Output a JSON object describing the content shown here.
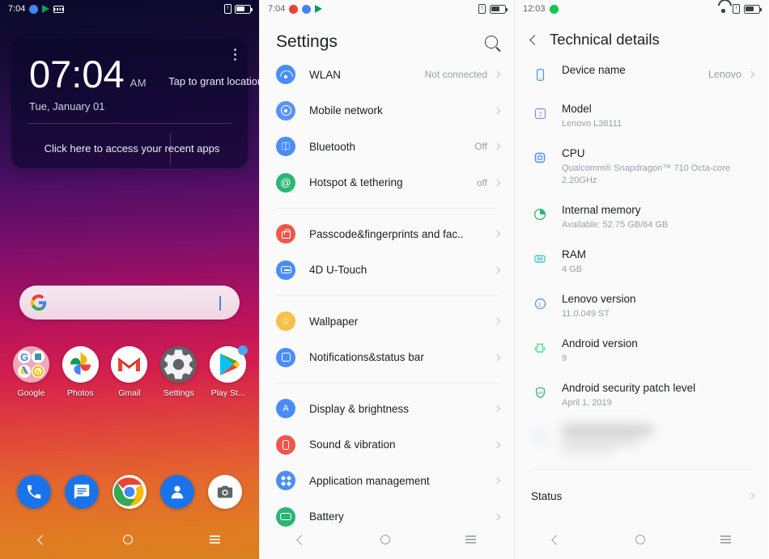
{
  "home": {
    "statusbar": {
      "time": "7:04",
      "icons": [
        "blue-dot-icon",
        "play-store-icon",
        "keyboard-icon"
      ],
      "sim_icon": "sim-card-icon",
      "battery_icon": "battery-icon"
    },
    "clock_widget": {
      "time": "07:04",
      "ampm": "AM",
      "location_prompt": "Tap to grant location",
      "date": "Tue, January 01",
      "recent_apps_text": "Click here to access your recent apps",
      "overflow_icon": "more-vertical-icon"
    },
    "search": {
      "google_icon": "google-g-icon",
      "mic_icon": "microphone-icon",
      "placeholder": ""
    },
    "apps": [
      {
        "label": "Google",
        "icon": "google-folder-icon"
      },
      {
        "label": "Photos",
        "icon": "google-photos-icon"
      },
      {
        "label": "Gmail",
        "icon": "gmail-icon"
      },
      {
        "label": "Settings",
        "icon": "settings-gear-icon"
      },
      {
        "label": "Play St...",
        "icon": "play-store-icon"
      }
    ],
    "dock": [
      {
        "name": "phone-icon"
      },
      {
        "name": "messages-icon"
      },
      {
        "name": "chrome-icon"
      },
      {
        "name": "contacts-icon"
      },
      {
        "name": "camera-icon"
      }
    ],
    "navbar": {
      "back": "back-icon",
      "home": "home-icon",
      "recents": "recents-icon"
    }
  },
  "settings": {
    "statusbar": {
      "time": "7:04",
      "sim_icon": "sim-card-icon",
      "battery_icon": "battery-icon"
    },
    "title": "Settings",
    "search_icon": "search-icon",
    "groups": [
      {
        "items": [
          {
            "label": "WLAN",
            "value": "Not connected",
            "icon": "wifi-icon",
            "color": "#4b8df8"
          },
          {
            "label": "Mobile network",
            "value": "",
            "icon": "mobile-network-icon",
            "color": "#5c92f8"
          },
          {
            "label": "Bluetooth",
            "value": "Off",
            "icon": "bluetooth-icon",
            "color": "#4b8df8"
          },
          {
            "label": "Hotspot & tethering",
            "value": "off",
            "icon": "hotspot-icon",
            "color": "#2bb673"
          }
        ]
      },
      {
        "items": [
          {
            "label": "Passcode&fingerprints and fac..",
            "value": "",
            "icon": "lock-icon",
            "color": "#f0564a"
          },
          {
            "label": "4D U-Touch",
            "value": "",
            "icon": "u-touch-icon",
            "color": "#4b8df8"
          }
        ]
      },
      {
        "items": [
          {
            "label": "Wallpaper",
            "value": "",
            "icon": "star-icon",
            "color": "#f7c04a"
          },
          {
            "label": "Notifications&status bar",
            "value": "",
            "icon": "notifications-icon",
            "color": "#4b8df8"
          }
        ]
      },
      {
        "items": [
          {
            "label": "Display & brightness",
            "value": "",
            "icon": "brightness-icon",
            "color": "#4b8df8"
          },
          {
            "label": "Sound & vibration",
            "value": "",
            "icon": "vibration-icon",
            "color": "#f0564a"
          },
          {
            "label": "Application management",
            "value": "",
            "icon": "apps-grid-icon",
            "color": "#4b8df8"
          },
          {
            "label": "Battery",
            "value": "",
            "icon": "battery-icon",
            "color": "#2bb673"
          }
        ]
      }
    ],
    "navbar": {
      "back": "back-icon",
      "home": "home-icon",
      "recents": "recents-icon"
    }
  },
  "technical": {
    "statusbar": {
      "time": "12:03",
      "dot_icon": "green-dot-icon",
      "wifi_icon": "wifi-icon",
      "sim_icon": "sim-card-icon",
      "battery_icon": "battery-icon"
    },
    "back_icon": "back-arrow-icon",
    "title": "Technical details",
    "items": [
      {
        "label": "Device name",
        "sub": "",
        "value": "Lenovo",
        "chevron": true,
        "icon": "phone-outline-icon",
        "color": "#4b8df8"
      },
      {
        "label": "Model",
        "sub": "Lenovo L38111",
        "value": "",
        "chevron": false,
        "icon": "model-z-icon",
        "color": "#9b7fe0"
      },
      {
        "label": "CPU",
        "sub": "Qualcomm® Snapdragon™ 710 Octa-core 2.20GHz",
        "value": "",
        "chevron": false,
        "icon": "cpu-icon",
        "color": "#4b8df8"
      },
      {
        "label": "Internal memory",
        "sub": "Available: 52.75 GB/64 GB",
        "value": "",
        "chevron": false,
        "icon": "pie-chart-icon",
        "color": "#2bb673"
      },
      {
        "label": "RAM",
        "sub": "4 GB",
        "value": "",
        "chevron": false,
        "icon": "ram-chip-icon",
        "color": "#3ec6cf"
      },
      {
        "label": "Lenovo version",
        "sub": "11.0.049 ST",
        "value": "",
        "chevron": false,
        "icon": "lenovo-l-icon",
        "color": "#4b8df8"
      },
      {
        "label": "Android version",
        "sub": "9",
        "value": "",
        "chevron": false,
        "icon": "android-robot-icon",
        "color": "#3ddc84"
      },
      {
        "label": "Android security patch level",
        "sub": "April 1, 2019",
        "value": "",
        "chevron": false,
        "icon": "shield-icon",
        "color": "#2bb673"
      }
    ],
    "redacted_row": {
      "label": "",
      "sub": "",
      "note": "blurred"
    },
    "status_label": "Status",
    "navbar": {
      "back": "back-icon",
      "home": "home-icon",
      "recents": "recents-icon"
    }
  }
}
